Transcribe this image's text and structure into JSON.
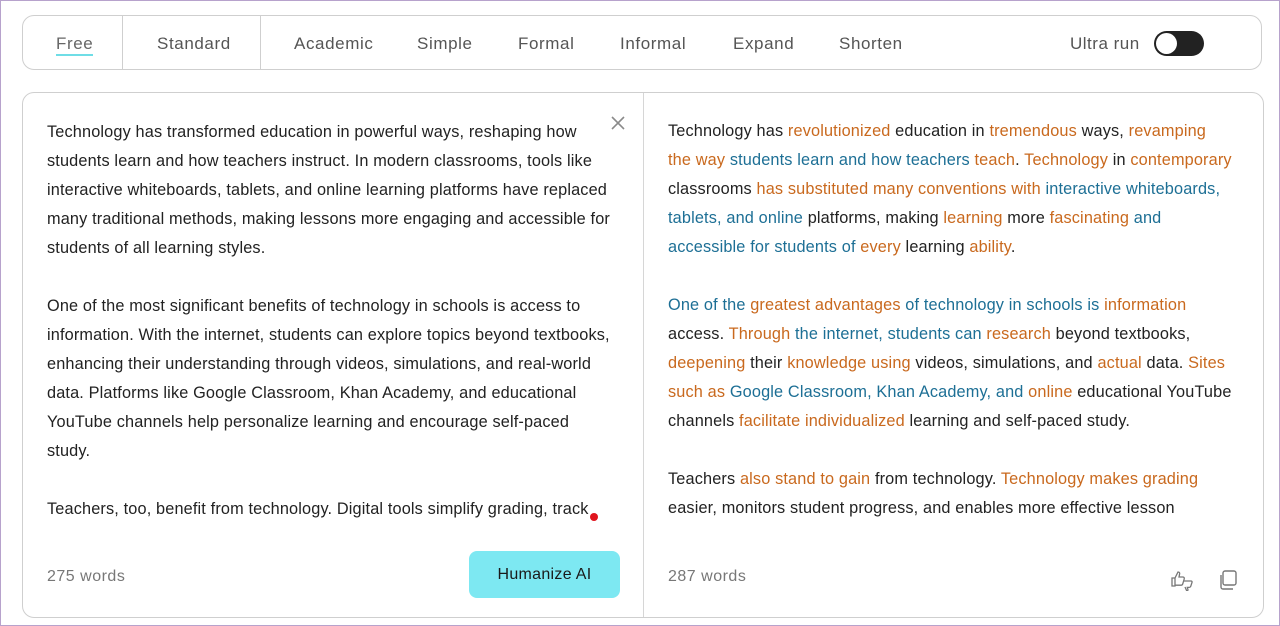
{
  "modes": {
    "free": "Free",
    "standard": "Standard",
    "academic": "Academic",
    "simple": "Simple",
    "formal": "Formal",
    "informal": "Informal",
    "expand": "Expand",
    "shorten": "Shorten"
  },
  "ultra_run": {
    "label": "Ultra run",
    "enabled": true
  },
  "input": {
    "paragraphs": [
      "Technology has transformed education in powerful ways, reshaping how students learn and how teachers instruct. In modern classrooms, tools like interactive whiteboards, tablets, and online learning platforms have replaced many traditional methods, making lessons more engaging and accessible for students of all learning styles.",
      "One of the most significant benefits of technology in schools is access to information. With the internet, students can explore topics beyond textbooks, enhancing their understanding through videos, simulations, and real-world data. Platforms like Google Classroom, Khan Academy, and educational YouTube channels help personalize learning and encourage self-paced study.",
      "Teachers, too, benefit from technology. Digital tools simplify grading, track student progress, and allow for better lesson planning. Programs"
    ],
    "word_count": "275 words",
    "humanize_label": "Humanize AI"
  },
  "output": {
    "p1": {
      "s1": "Technology has ",
      "s2": "revolutionized",
      "s3": " education in ",
      "s4": "tremendous",
      "s5": " ways, ",
      "s6": "revamping the way",
      "s7": " students learn and how teachers ",
      "s8": "teach",
      "s9": ". ",
      "s10": "Technology",
      "s11": " in ",
      "s12": "contemporary",
      "s13": " classrooms ",
      "s14": "has substituted many conventions with",
      "s15": " ",
      "s16": "interactive whiteboards, tablets, and online",
      "s17": " platforms, making ",
      "s18": "learning",
      "s19": " more ",
      "s20": "fascinating",
      "s21": " and accessible for students of ",
      "s22": "every",
      "s23": " learning ",
      "s24": "ability",
      "s25": "."
    },
    "p2": {
      "s1": "One of the ",
      "s2": "greatest advantages",
      "s3": " of technology in schools is ",
      "s4": "information",
      "s5": " access. ",
      "s6": "Through",
      "s7": " the internet, students can ",
      "s8": "research",
      "s9": " beyond textbooks, ",
      "s10": "deepening",
      "s11": " their ",
      "s12": "knowledge using",
      "s13": " videos, simulations, and ",
      "s14": "actual",
      "s15": " data. ",
      "s16": "Sites such as",
      "s17": " Google Classroom, Khan Academy, and ",
      "s18": "online",
      "s19": " educational YouTube channels ",
      "s20": "facilitate individualized",
      "s21": " learning and self-paced study."
    },
    "p3": {
      "s1": "Teachers ",
      "s2": "also stand to gain",
      "s3": " from technology. ",
      "s4": "Technology makes grading",
      "s5": " easier, monitors student progress, and enables more effective lesson"
    },
    "word_count": "287 words"
  },
  "colors": {
    "accent": "#7de8f2",
    "changed": "#c9691e",
    "kept": "#1d6f95",
    "toggle": "#222222"
  },
  "icons": {
    "close": "close-icon",
    "feedback": "thumbs-up-down-icon",
    "copy": "copy-icon"
  }
}
